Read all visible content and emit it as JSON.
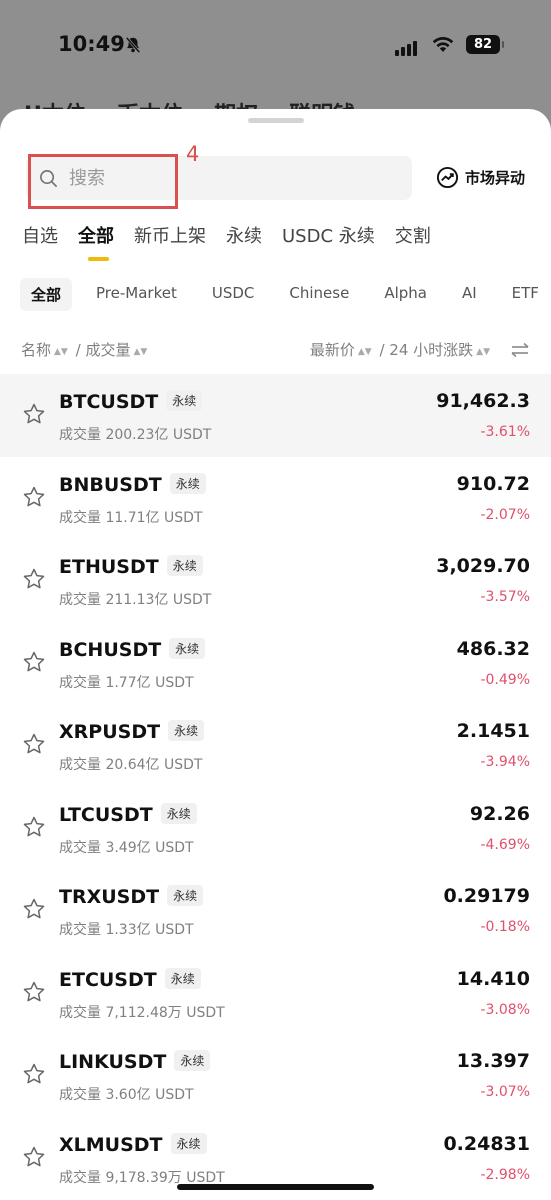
{
  "status": {
    "time": "10:49",
    "battery": "82"
  },
  "background_tabs": [
    "U本位",
    "币本位",
    "期权",
    "聪明钱"
  ],
  "search": {
    "placeholder": "搜索"
  },
  "annotation": {
    "number": "4",
    "color": "#d9504f"
  },
  "market_button": {
    "label": "市场异动"
  },
  "tabs": [
    {
      "label": "自选",
      "active": false
    },
    {
      "label": "全部",
      "active": true
    },
    {
      "label": "新币上架",
      "active": false
    },
    {
      "label": "永续",
      "active": false
    },
    {
      "label": "USDC 永续",
      "active": false
    },
    {
      "label": "交割",
      "active": false
    }
  ],
  "chips": [
    {
      "label": "全部",
      "active": true
    },
    {
      "label": "Pre-Market",
      "active": false
    },
    {
      "label": "USDC",
      "active": false
    },
    {
      "label": "Chinese",
      "active": false
    },
    {
      "label": "Alpha",
      "active": false
    },
    {
      "label": "AI",
      "active": false
    },
    {
      "label": "ETF",
      "active": false
    }
  ],
  "columns": {
    "name": "名称",
    "separator": "/",
    "volume": "成交量",
    "price": "最新价",
    "change": "24 小时涨跌"
  },
  "accent_color": "#f0b90b",
  "negative_color": "#e0506a",
  "rows": [
    {
      "symbol": "BTCUSDT",
      "badge": "永续",
      "volume": "成交量 200.23亿 USDT",
      "price": "91,462.3",
      "change": "-3.61%"
    },
    {
      "symbol": "BNBUSDT",
      "badge": "永续",
      "volume": "成交量 11.71亿 USDT",
      "price": "910.72",
      "change": "-2.07%"
    },
    {
      "symbol": "ETHUSDT",
      "badge": "永续",
      "volume": "成交量 211.13亿 USDT",
      "price": "3,029.70",
      "change": "-3.57%"
    },
    {
      "symbol": "BCHUSDT",
      "badge": "永续",
      "volume": "成交量 1.77亿 USDT",
      "price": "486.32",
      "change": "-0.49%"
    },
    {
      "symbol": "XRPUSDT",
      "badge": "永续",
      "volume": "成交量 20.64亿 USDT",
      "price": "2.1451",
      "change": "-3.94%"
    },
    {
      "symbol": "LTCUSDT",
      "badge": "永续",
      "volume": "成交量 3.49亿 USDT",
      "price": "92.26",
      "change": "-4.69%"
    },
    {
      "symbol": "TRXUSDT",
      "badge": "永续",
      "volume": "成交量 1.33亿 USDT",
      "price": "0.29179",
      "change": "-0.18%"
    },
    {
      "symbol": "ETCUSDT",
      "badge": "永续",
      "volume": "成交量 7,112.48万 USDT",
      "price": "14.410",
      "change": "-3.08%"
    },
    {
      "symbol": "LINKUSDT",
      "badge": "永续",
      "volume": "成交量 3.60亿 USDT",
      "price": "13.397",
      "change": "-3.07%"
    },
    {
      "symbol": "XLMUSDT",
      "badge": "永续",
      "volume": "成交量 9,178.39万 USDT",
      "price": "0.24831",
      "change": "-2.98%"
    }
  ]
}
